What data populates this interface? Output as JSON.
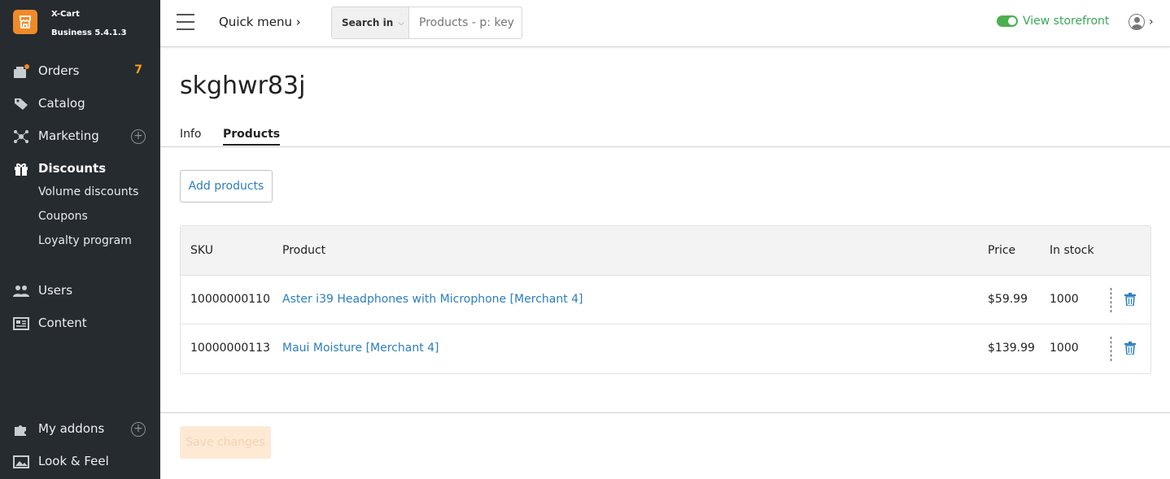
{
  "brand": {
    "name": "X-Cart",
    "version": "Business 5.4.1.3"
  },
  "sidebar": {
    "items": [
      {
        "label": "Orders",
        "badge": "7",
        "icon": "orders-icon"
      },
      {
        "label": "Catalog",
        "icon": "tag-icon"
      },
      {
        "label": "Marketing",
        "icon": "marketing-icon"
      },
      {
        "label": "Discounts",
        "icon": "gift-icon"
      },
      {
        "label": "Volume discounts"
      },
      {
        "label": "Coupons"
      },
      {
        "label": "Loyalty program"
      },
      {
        "label": "Users",
        "icon": "users-icon"
      },
      {
        "label": "Content",
        "icon": "content-icon"
      },
      {
        "label": "My addons",
        "icon": "puzzle-icon"
      },
      {
        "label": "Look & Feel",
        "icon": "image-icon"
      }
    ]
  },
  "header": {
    "quick_menu": "Quick menu ›",
    "search_in": "Search in",
    "search_placeholder": "Products - p: key",
    "view_storefront": "View storefront"
  },
  "page": {
    "title": "skghwr83j",
    "tabs": [
      "Info",
      "Products"
    ],
    "active_tab": "Products",
    "add_products": "Add products",
    "save_changes": "Save changes"
  },
  "table": {
    "columns": [
      "SKU",
      "Product",
      "Price",
      "In stock"
    ],
    "rows": [
      {
        "sku": "10000000110",
        "product": "Aster i39 Headphones with Microphone [Merchant 4]",
        "price": "$59.99",
        "stock": "1000"
      },
      {
        "sku": "10000000113",
        "product": "Maui Moisture [Merchant 4]",
        "price": "$139.99",
        "stock": "1000"
      }
    ]
  },
  "colors": {
    "accent": "#2b7ec1",
    "sidebar_bg": "#262b30",
    "brand_orange": "#f08a29",
    "storefront_green": "#3aa756"
  }
}
